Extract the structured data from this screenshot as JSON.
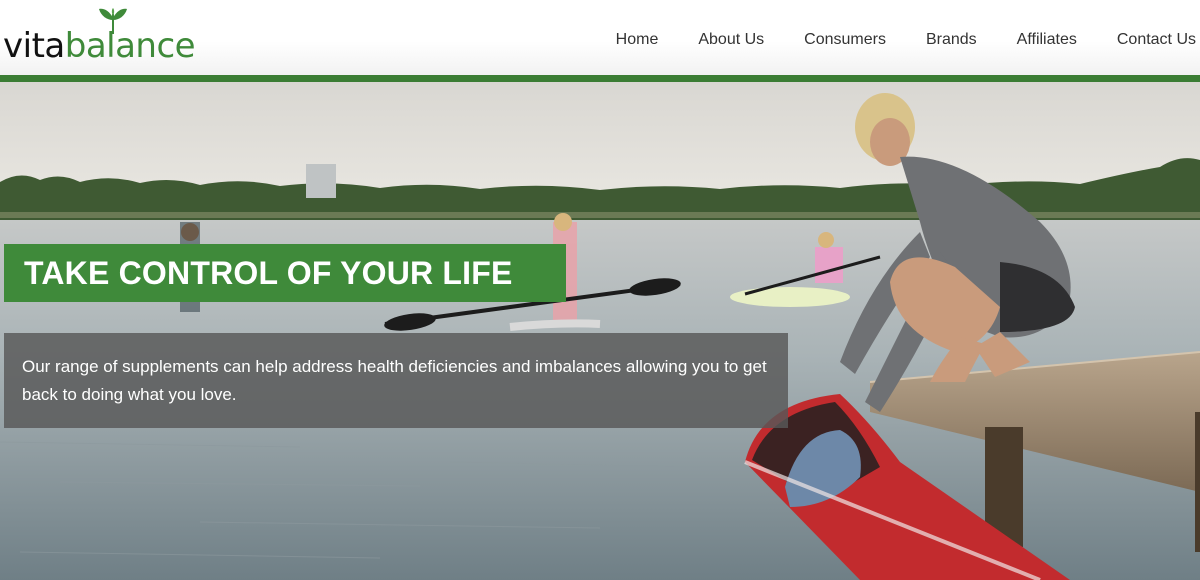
{
  "brand": {
    "logo_part1": "vita",
    "logo_part2": "balance",
    "logo_icon": "leaf-sprout-icon",
    "accent_color": "#3f8a3a"
  },
  "nav": {
    "items": [
      {
        "label": "Home"
      },
      {
        "label": "About Us"
      },
      {
        "label": "Consumers"
      },
      {
        "label": "Brands"
      },
      {
        "label": "Affiliates"
      },
      {
        "label": "Contact Us"
      }
    ]
  },
  "hero": {
    "image_subject": "kayakers on a lake and a woman crouching on a wooden dock beside a red kayak",
    "headline": "TAKE CONTROL OF YOUR LIFE",
    "description": "Our range of supplements can help address health deficiencies and imbalances allowing you to get back to doing what you love."
  }
}
